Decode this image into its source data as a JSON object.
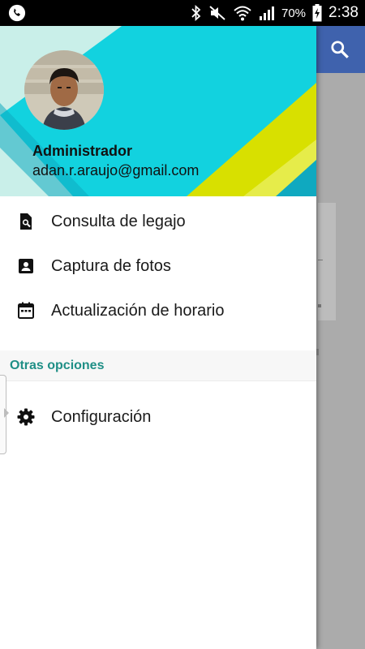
{
  "status_bar": {
    "battery_percent": "70%",
    "time": "2:38",
    "icons": [
      "phone-icon",
      "bluetooth-icon",
      "mute-icon",
      "wifi-icon",
      "signal-icon",
      "battery-charging-icon"
    ]
  },
  "background_app": {
    "toolbar_color": "#3f62ad",
    "search_icon": "search-icon"
  },
  "drawer": {
    "header": {
      "user_name": "Administrador",
      "user_email": "adan.r.araujo@gmail.com",
      "colors": {
        "teal": "#12d2df",
        "mint": "#c9efe9",
        "yellow": "#d8e000"
      }
    },
    "items": [
      {
        "label": "Consulta de legajo",
        "icon": "document-search-icon"
      },
      {
        "label": "Captura de fotos",
        "icon": "contact-card-icon"
      },
      {
        "label": "Actualización de horario",
        "icon": "calendar-icon"
      }
    ],
    "section": {
      "label": "Otras opciones",
      "color": "#1f8f86",
      "items": [
        {
          "label": "Configuración",
          "icon": "gear-icon"
        }
      ]
    }
  }
}
